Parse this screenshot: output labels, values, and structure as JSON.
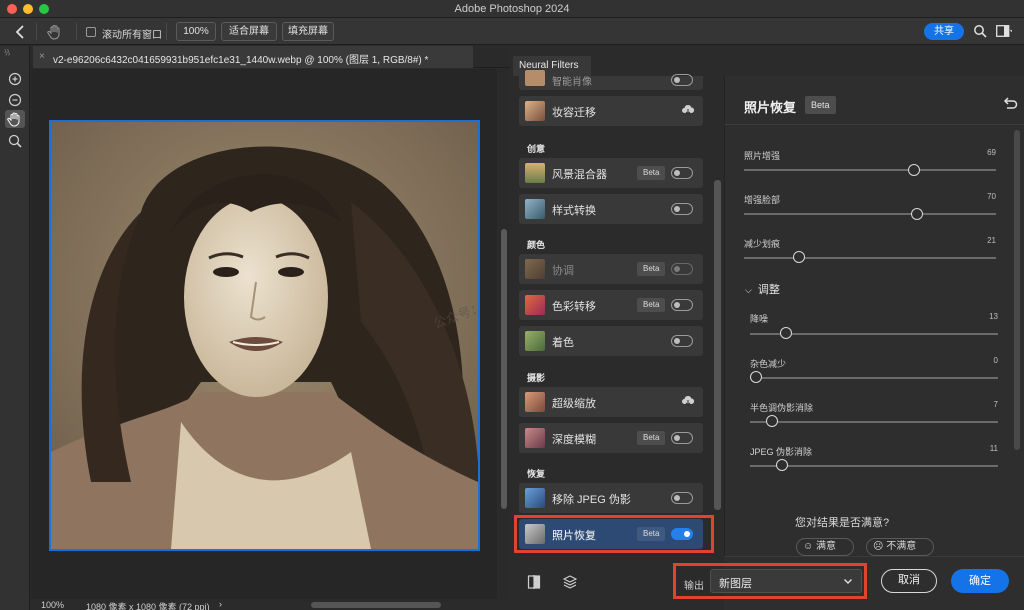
{
  "app": {
    "title": "Adobe Photoshop 2024"
  },
  "options_bar": {
    "scroll_all_windows": "滚动所有窗口",
    "zoom_100": "100%",
    "fit_screen": "适合屏幕",
    "fill_screen": "填充屏幕",
    "share": "共享"
  },
  "document": {
    "tab_title": "v2-e96206c6432c041659931b951efc1e31_1440w.webp @ 100% (图层 1, RGB/8#) *",
    "watermark": "公众号：",
    "status_zoom": "100%",
    "status_info": "1080 像素 x 1080 像素 (72 ppi)"
  },
  "neural_filters": {
    "tab_label": "Neural Filters",
    "top_partial_item": "智能肖像",
    "categories": {
      "creative": "创意",
      "color": "颜色",
      "photography": "摄影",
      "restoration": "恢复"
    },
    "items": {
      "makeup": {
        "name": "妆容迁移"
      },
      "landscape": {
        "name": "风景混合器",
        "badge": "Beta"
      },
      "style": {
        "name": "样式转换"
      },
      "harmonize": {
        "name": "协调",
        "badge": "Beta"
      },
      "color_transfer": {
        "name": "色彩转移",
        "badge": "Beta"
      },
      "colorize": {
        "name": "着色"
      },
      "super_zoom": {
        "name": "超级缩放"
      },
      "depth_blur": {
        "name": "深度模糊",
        "badge": "Beta"
      },
      "jpeg_removal": {
        "name": "移除 JPEG 伪影"
      },
      "photo_restore": {
        "name": "照片恢复",
        "badge": "Beta",
        "enabled": true
      }
    }
  },
  "settings": {
    "title": "照片恢复",
    "beta": "Beta",
    "sliders": {
      "enhance": {
        "label": "照片增强",
        "value": "69"
      },
      "face": {
        "label": "增强脸部",
        "value": "70"
      },
      "scratch": {
        "label": "减少划痕",
        "value": "21"
      },
      "denoise": {
        "label": "降噪",
        "value": "13"
      },
      "color_noise": {
        "label": "杂色减少",
        "value": "0"
      },
      "halftone": {
        "label": "半色调伪影消除",
        "value": "7"
      },
      "jpeg": {
        "label": "JPEG 伪影消除",
        "value": "11"
      }
    },
    "adjust_section": "调整",
    "satisfied_question": "您对结果是否满意?",
    "yes": "满意",
    "no": "不满意"
  },
  "footer": {
    "output_label": "输出",
    "output_value": "新图层",
    "cancel": "取消",
    "ok": "确定"
  },
  "colors": {
    "accent": "#1473e6",
    "highlight": "#e2432f",
    "selection": "#2c4a73"
  }
}
